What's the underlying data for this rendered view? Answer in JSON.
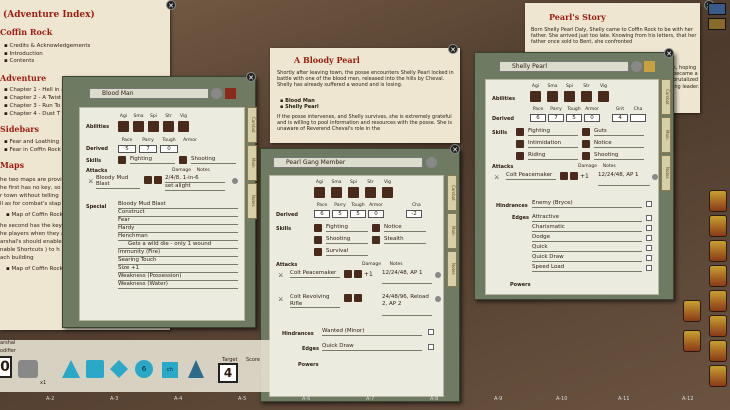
{
  "index": {
    "title": "(Adventure Index)",
    "heading1": "Coffin Rock",
    "items1": [
      "Credits & Acknowledgements",
      "Introduction",
      "Contents"
    ],
    "heading2": "Adventure",
    "items2": [
      "Chapter 1 - Hell in a",
      "Chapter 2 - A Twist",
      "Chapter 3 - Run To",
      "Chapter 4 - Dust T"
    ],
    "heading3": "Sidebars",
    "items3": [
      "Fear and Loathing",
      "Fear in Coffin Rock"
    ],
    "heading4": "Maps",
    "text1": "he two maps are provided",
    "text2": "he first has no key, so is",
    "text3": "r town without telling",
    "text4": "ll as for combat's stap",
    "map1": "Map of Coffin Rock",
    "text5": "he second has the key",
    "text6": "he players when they a",
    "text7": "arshal's should enable",
    "text8": "nable Shortcuts ) to h",
    "text9": "ach building",
    "map2": "Map of Coffin Rock"
  },
  "bloody": {
    "title": "A Bloody Pearl",
    "p1": "Shortly after leaving town, the posse encounters Shelly Pearl locked in battle with one of the blood men, released into the hills by Cheval. Shelly has already suffered a wound and is losing.",
    "link1": "Blood Man",
    "link2": "Shelly Pearl",
    "p2": "If the posse intervenes, and Shelly survives, she is extremely grateful and is willing to pool information and resources with the posse. She is unaware of Reverend Cheval's role in the"
  },
  "story": {
    "title": "Pearl's Story",
    "text": "Born Shelly Pearl Daly, Shelly came to Coffin Rock to be with her father. She arrived just too late. Knowing from his letters, that her father once sold to Bent, she confronted"
  },
  "story_right": [
    "k, hoping",
    "became a",
    "brutalized",
    "ing leader."
  ],
  "blood_man": {
    "name": "Blood Man",
    "abilities_label": "Abilities",
    "ability_names": [
      "Agi",
      "Sma",
      "Spi",
      "Str",
      "Vig"
    ],
    "derived_label": "Derived",
    "derived_names": [
      "Pace",
      "Parry",
      "Tough",
      "Armor"
    ],
    "derived_values": [
      "5",
      "7",
      "0"
    ],
    "skills_label": "Skills",
    "skills": [
      "Fighting",
      "Shooting"
    ],
    "attacks_label": "Attacks",
    "damage_label": "Damage",
    "notes_label": "Notes",
    "attack_name": "Bloody Mud Blast",
    "attack_damage": "2/4/8, 1-in-6",
    "attack_notes": "set alight",
    "special_label": "Special",
    "specials": [
      "Bloody Mud Blast",
      "Construct",
      "Fear",
      "Hardy",
      "Henchman",
      "Gets a wild die - only 1 wound",
      "Immunity (Fire)",
      "Searing Touch",
      "Size +1",
      "Weakness (Possession)",
      "Weakness (Water)"
    ]
  },
  "gang": {
    "name": "Pearl Gang Member",
    "ability_names": [
      "Agi",
      "Sma",
      "Spi",
      "Str",
      "Vig"
    ],
    "derived_label": "Derived",
    "derived_names": [
      "Pace",
      "Parry",
      "Tough",
      "Armor",
      "Cha"
    ],
    "derived_values": [
      "6",
      "5",
      "5",
      "0",
      "-2"
    ],
    "skills_label": "Skills",
    "skills": [
      "Fighting",
      "Notice",
      "Shooting",
      "Stealth",
      "Survival"
    ],
    "attacks_label": "Attacks",
    "damage_label": "Damage",
    "notes_label": "Notes",
    "attack1": "Colt Peacemaker",
    "attack1_mod": "+1",
    "attack1_notes": "12/24/48, AP 1",
    "attack2": "Colt Revolving Rifle",
    "attack2_notes": "24/48/96, Reload 2, AP 2",
    "hindrances_label": "Hindrances",
    "hindrance": "Wanted (Minor)",
    "edges_label": "Edges",
    "edge": "Quick Draw",
    "powers_label": "Powers"
  },
  "shelly": {
    "name": "Shelly Pearl",
    "abilities_label": "Abilities",
    "ability_names": [
      "Agi",
      "Sma",
      "Spi",
      "Str",
      "Vig"
    ],
    "derived_label": "Derived",
    "derived_names": [
      "Pace",
      "Parry",
      "Tough",
      "Armor",
      "Grit",
      "Cha"
    ],
    "derived_values": [
      "6",
      "7",
      "5",
      "0",
      "4"
    ],
    "skills_label": "Skills",
    "skills": [
      "Fighting",
      "Guts",
      "Intimidation",
      "Notice",
      "Riding",
      "Shooting"
    ],
    "attacks_label": "Attacks",
    "damage_label": "Damage",
    "notes_label": "Notes",
    "attack": "Colt Peacemaker",
    "attack_mod": "+1",
    "attack_notes": "12/24/48, AP 1",
    "hindrances_label": "Hindrances",
    "hindrance": "Enemy (Bryce)",
    "edges_label": "Edges",
    "edges": [
      "Attractive",
      "Charismatic",
      "Dodge",
      "Quick",
      "Quick Draw",
      "Speed Load"
    ],
    "powers_label": "Powers"
  },
  "tabs": [
    "Combat",
    "Main",
    "Notes"
  ],
  "bottom": {
    "role": "arshal",
    "modifier": "odifier",
    "mod_value": "0",
    "target_label": "Target",
    "target_value": "4",
    "score_label": "Score",
    "d6": "6",
    "d4": "4",
    "ch": "ch",
    "x1": "x1"
  },
  "grid": [
    "A-2",
    "A-3",
    "A-4",
    "A-5",
    "A-6",
    "A-7",
    "A-8",
    "A-9",
    "A-10",
    "A-11",
    "A-12"
  ],
  "colors": {
    "title_red": "#9b1c10",
    "sheet_frame": "#6f7a62",
    "paper": "#efe6d2",
    "die": "#4a2a1a"
  }
}
